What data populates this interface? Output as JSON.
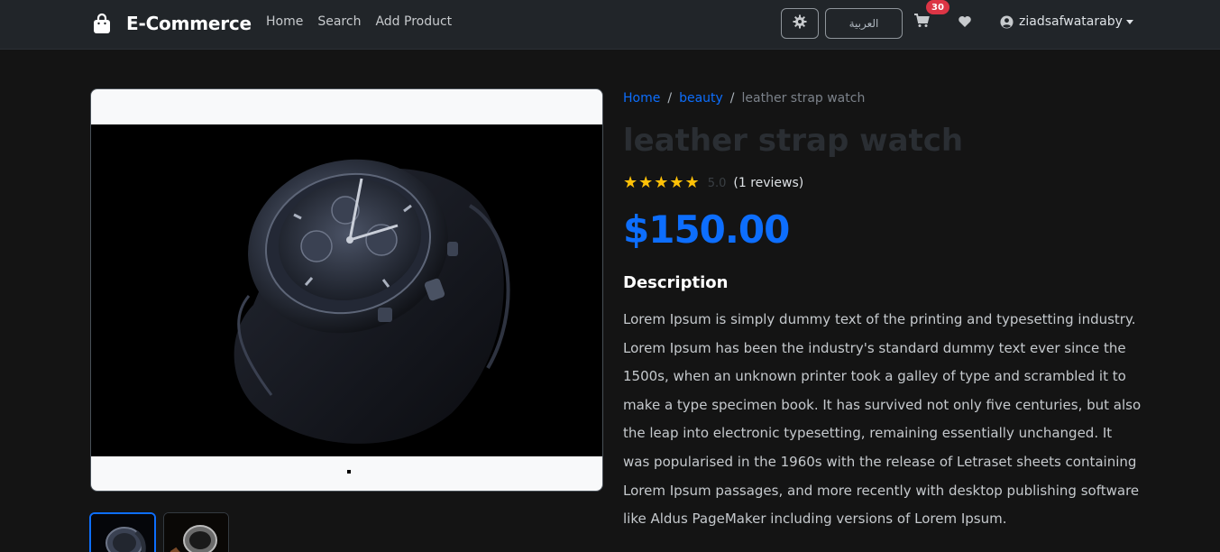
{
  "navbar": {
    "brand": "E-Commerce",
    "links": [
      {
        "label": "Home"
      },
      {
        "label": "Search"
      },
      {
        "label": "Add Product"
      }
    ],
    "language_button": "العربية",
    "cart_count": "30",
    "username": "ziadsafwataraby"
  },
  "breadcrumb": {
    "home": "Home",
    "category": "beauty",
    "current": "leather strap watch"
  },
  "product": {
    "title": "leather strap watch",
    "rating_value": "5.0",
    "rating_stars": 5,
    "reviews_label": "(1 reviews)",
    "price": "$150.00",
    "description_heading": "Description",
    "description": "Lorem Ipsum is simply dummy text of the printing and typesetting industry. Lorem Ipsum has been the industry's standard dummy text ever since the 1500s, when an unknown printer took a galley of type and scrambled it to make a type specimen book. It has survived not only five centuries, but also the leap into electronic typesetting, remaining essentially unchanged. It was popularised in the 1960s with the release of Letraset sheets containing Lorem Ipsum passages, and more recently with desktop publishing software like Aldus PageMaker including versions of Lorem Ipsum."
  },
  "colors": {
    "accent": "#0d6efd",
    "star": "#ffc107",
    "badge": "#dc3545",
    "background": "#141414",
    "navbar": "#212529"
  },
  "icons": [
    "shopping-bag-icon",
    "gear-icon",
    "cart-icon",
    "heart-icon",
    "user-circle-icon",
    "star-icon"
  ]
}
